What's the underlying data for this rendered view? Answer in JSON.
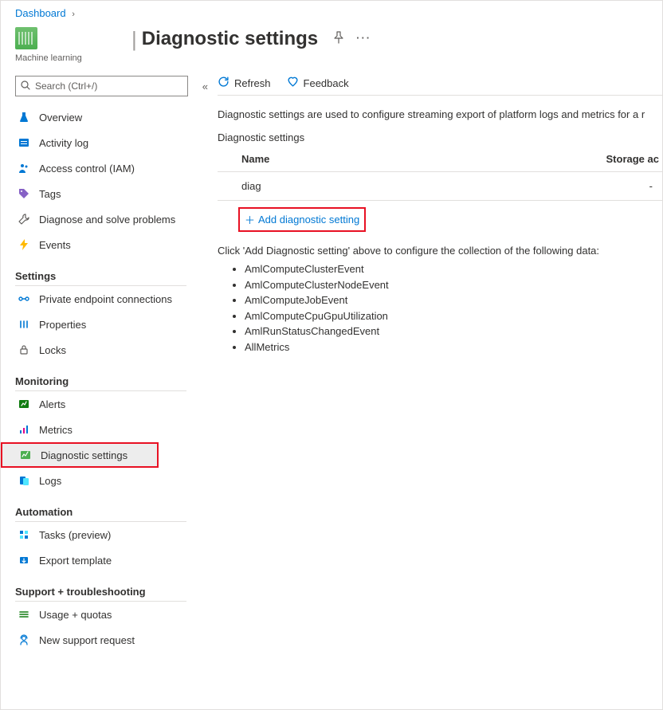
{
  "breadcrumb": {
    "dashboard": "Dashboard"
  },
  "header": {
    "resource_type": "Machine learning",
    "title": "Diagnostic settings"
  },
  "search": {
    "placeholder": "Search (Ctrl+/)"
  },
  "nav": {
    "top": {
      "overview": "Overview",
      "activity": "Activity log",
      "iam": "Access control (IAM)",
      "tags": "Tags",
      "diagnose": "Diagnose and solve problems",
      "events": "Events"
    },
    "groups": {
      "settings": "Settings",
      "monitoring": "Monitoring",
      "automation": "Automation",
      "support": "Support + troubleshooting"
    },
    "settings": {
      "pec": "Private endpoint connections",
      "properties": "Properties",
      "locks": "Locks"
    },
    "monitoring": {
      "alerts": "Alerts",
      "metrics": "Metrics",
      "diagnostic": "Diagnostic settings",
      "logs": "Logs"
    },
    "automation": {
      "tasks": "Tasks (preview)",
      "export": "Export template"
    },
    "support": {
      "usage": "Usage + quotas",
      "newreq": "New support request"
    }
  },
  "toolbar": {
    "refresh": "Refresh",
    "feedback": "Feedback"
  },
  "main": {
    "description": "Diagnostic settings are used to configure streaming export of platform logs and metrics for a r",
    "subheading": "Diagnostic settings",
    "columns": {
      "name": "Name",
      "storage": "Storage ac"
    },
    "rows": [
      {
        "name": "diag",
        "storage": "-"
      }
    ],
    "add_label": "Add diagnostic setting",
    "info": "Click 'Add Diagnostic setting' above to configure the collection of the following data:",
    "events": [
      "AmlComputeClusterEvent",
      "AmlComputeClusterNodeEvent",
      "AmlComputeJobEvent",
      "AmlComputeCpuGpuUtilization",
      "AmlRunStatusChangedEvent",
      "AllMetrics"
    ]
  }
}
